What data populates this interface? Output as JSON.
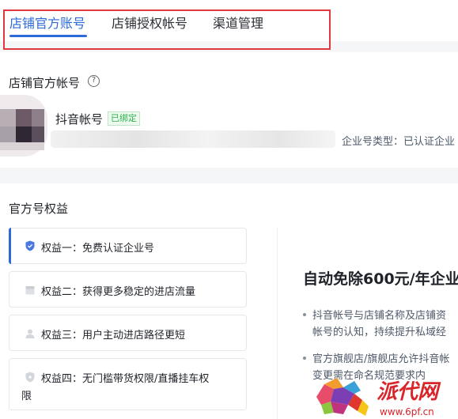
{
  "tabs": [
    {
      "label": "店铺官方账号",
      "active": true
    },
    {
      "label": "店铺授权帐号",
      "active": false
    },
    {
      "label": "渠道管理",
      "active": false
    }
  ],
  "official_account": {
    "title": "店铺官方帐号",
    "help_glyph": "?",
    "account_name": "抖音帐号",
    "bound_badge": "已绑定",
    "company_type": "企业号类型：已认证企业"
  },
  "benefits": {
    "title": "官方号权益",
    "items": [
      {
        "label": "权益一：免费认证企业号",
        "icon": "shield-verified-icon",
        "active": true
      },
      {
        "label": "权益二：获得更多稳定的进店流量",
        "icon": "storefront-icon",
        "active": false
      },
      {
        "label": "权益三：用户主动进店路径更短",
        "icon": "user-icon",
        "active": false
      },
      {
        "label": "权益四：无门槛带货权限/直播挂车权",
        "label_cont": "限",
        "icon": "shield-icon",
        "active": false
      }
    ]
  },
  "detail": {
    "title": "自动免除600元/年企业",
    "lines": [
      "抖音帐号与店铺名称及店铺资",
      "帐号的认知，持续提升私域经",
      "官方旗舰店/旗舰店允许抖音帐",
      "变更需在命名规范要求内"
    ]
  },
  "watermark": {
    "brand_text": "派代网",
    "url_text": "www.6pf.cn"
  },
  "colors": {
    "accent": "#2d6ad9",
    "highlight_box": "#e0383e",
    "bound_green": "#2bb24c"
  }
}
